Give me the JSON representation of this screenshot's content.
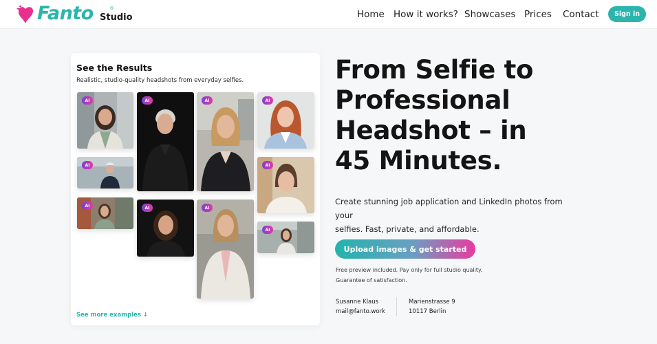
{
  "brand": {
    "name": "Fanto",
    "registered": "®",
    "sub": "Studio",
    "primary_color": "#2bb5ad",
    "accent_color": "#e8318f"
  },
  "nav": {
    "items": [
      "Home",
      "How it works?",
      "Showcases",
      "Prices",
      "Contact"
    ],
    "sign_in": "Sign in"
  },
  "results": {
    "title": "See the Results",
    "subtitle": "Realistic, studio-quality headshots from everyday selfies.",
    "badge": "AI",
    "see_more": "See more examples ↓"
  },
  "hero": {
    "title_lines": [
      "From Selfie to",
      "Professional",
      "Headshot – in",
      "45 Minutes."
    ],
    "description_lines": [
      "Create stunning job application and LinkedIn photos from your",
      "selfies. Fast, private, and affordable."
    ],
    "cta": "Upload images & get started",
    "note_lines": [
      "Free preview included. Pay only for full studio quality.",
      "Guarantee of satisfaction."
    ]
  },
  "contact": {
    "name": "Susanne Klaus",
    "email": "mail@fanto.work",
    "street": "Marienstrasse 9",
    "city": "10117 Berlin"
  }
}
